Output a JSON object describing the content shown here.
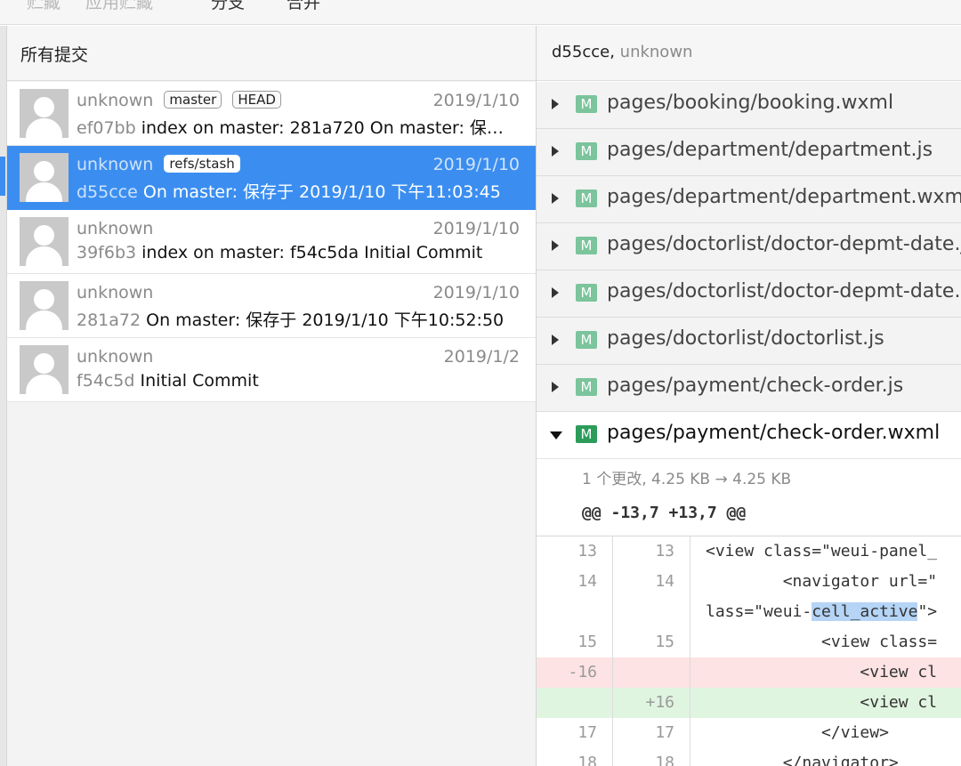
{
  "toolbar": {
    "items": [
      "贮藏",
      "应用贮藏",
      "分支",
      "合并"
    ]
  },
  "left": {
    "header": "所有提交",
    "commits": [
      {
        "author": "unknown",
        "tags": [
          "master",
          "HEAD"
        ],
        "date": "2019/1/10",
        "hash": "ef07bb",
        "message": "index on master: 281a720 On master: 保…",
        "selected": false
      },
      {
        "author": "unknown",
        "tags": [
          "refs/stash"
        ],
        "date": "2019/1/10",
        "hash": "d55cce",
        "message": "On master: 保存于 2019/1/10 下午11:03:45",
        "selected": true
      },
      {
        "author": "unknown",
        "tags": [],
        "date": "2019/1/10",
        "hash": "39f6b3",
        "message": "index on master: f54c5da Initial Commit",
        "selected": false
      },
      {
        "author": "unknown",
        "tags": [],
        "date": "2019/1/10",
        "hash": "281a72",
        "message": "On master: 保存于 2019/1/10 下午10:52:50",
        "selected": false
      },
      {
        "author": "unknown",
        "tags": [],
        "date": "2019/1/2",
        "hash": "f54c5d",
        "message": "Initial Commit",
        "selected": false
      }
    ]
  },
  "right": {
    "header_hash": "d55cce,",
    "header_author": "unknown",
    "files": [
      {
        "status": "M",
        "name": "pages/booking/booking.wxml",
        "expanded": false
      },
      {
        "status": "M",
        "name": "pages/department/department.js",
        "expanded": false
      },
      {
        "status": "M",
        "name": "pages/department/department.wxml",
        "expanded": false
      },
      {
        "status": "M",
        "name": "pages/doctorlist/doctor-depmt-date.js",
        "expanded": false
      },
      {
        "status": "M",
        "name": "pages/doctorlist/doctor-depmt-date.wxml",
        "expanded": false
      },
      {
        "status": "M",
        "name": "pages/doctorlist/doctorlist.js",
        "expanded": false
      },
      {
        "status": "M",
        "name": "pages/payment/check-order.js",
        "expanded": false
      },
      {
        "status": "M",
        "name": "pages/payment/check-order.wxml",
        "expanded": true
      }
    ],
    "diff_summary": "1 个更改, 4.25 KB → 4.25 KB",
    "hunk_header": "@@ -13,7 +13,7 @@",
    "diff_lines": [
      {
        "old": "13",
        "new": "13",
        "type": "ctx",
        "code": "<view class=\"weui-panel_"
      },
      {
        "old": "14",
        "new": "14",
        "type": "ctx",
        "code": "        <navigator url=\""
      },
      {
        "old": "",
        "new": "",
        "type": "ctx",
        "code_pre": "lass=\"weui-",
        "code_hl": "cell_active",
        "code_post": "\">"
      },
      {
        "old": "15",
        "new": "15",
        "type": "ctx",
        "code": "            <view class="
      },
      {
        "old": "-16",
        "new": "",
        "type": "del",
        "code": "                <view cl"
      },
      {
        "old": "",
        "new": "+16",
        "type": "add",
        "code": "                <view cl"
      },
      {
        "old": "17",
        "new": "17",
        "type": "ctx",
        "code": "            </view>"
      },
      {
        "old": "18",
        "new": "18",
        "type": "ctx",
        "code": "        </navigator>"
      }
    ]
  }
}
